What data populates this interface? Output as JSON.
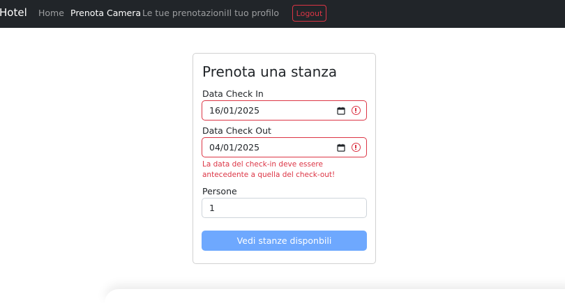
{
  "navbar": {
    "brand": "Hotel",
    "items": [
      {
        "label": "Home",
        "active": false
      },
      {
        "label": "Prenota Camera",
        "active": true
      },
      {
        "label": "Le tue prenotazioni",
        "active": false
      },
      {
        "label": "Il tuo profilo",
        "active": false
      }
    ],
    "logout_label": "Logout"
  },
  "form": {
    "title": "Prenota una stanza",
    "checkin": {
      "label": "Data Check In",
      "value": "16/01/2025",
      "invalid": true
    },
    "checkout": {
      "label": "Data Check Out",
      "value": "04/01/2025",
      "invalid": true
    },
    "error_message": "La data del check-in deve essere antecedente a quella del check-out!",
    "persons": {
      "label": "Persone",
      "value": "1"
    },
    "submit_label": "Vedi stanze disponbili"
  },
  "colors": {
    "navbar_bg": "#212529",
    "danger": "#dc3545",
    "primary_disabled": "#6ea8fe"
  },
  "icons": [
    "calendar-icon",
    "error-icon"
  ]
}
